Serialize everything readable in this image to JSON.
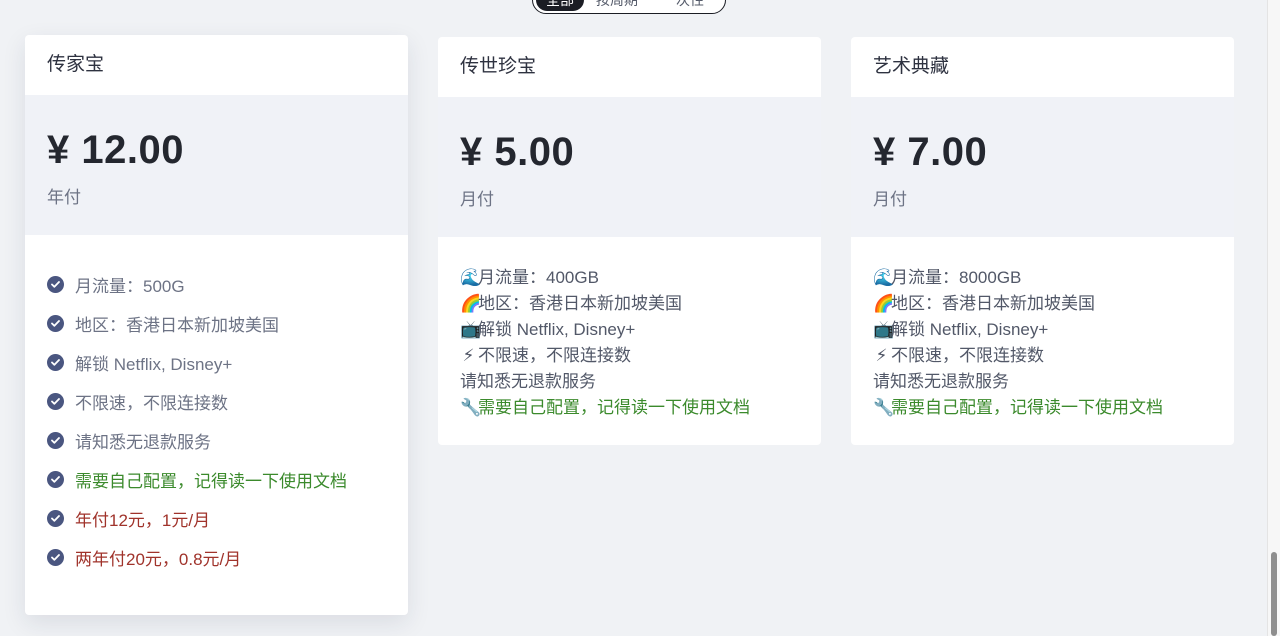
{
  "filter": {
    "tabs": [
      {
        "label": "全部",
        "active": true
      },
      {
        "label": "按周期",
        "active": false
      },
      {
        "label": "一次性",
        "active": false
      }
    ]
  },
  "plans": [
    {
      "name": "传家宝",
      "price": "¥ 12.00",
      "period": "年付",
      "features": [
        {
          "text": "月流量：500G",
          "tone": "normal"
        },
        {
          "text": "地区：香港日本新加坡美国",
          "tone": "normal"
        },
        {
          "text": "解锁 Netflix, Disney+",
          "tone": "normal"
        },
        {
          "text": "不限速，不限连接数",
          "tone": "normal"
        },
        {
          "text": "请知悉无退款服务",
          "tone": "normal"
        },
        {
          "text": "需要自己配置，记得读一下使用文档",
          "tone": "green"
        },
        {
          "text": "年付12元，1元/月",
          "tone": "red"
        },
        {
          "text": "两年付20元，0.8元/月",
          "tone": "red"
        }
      ]
    },
    {
      "name": "传世珍宝",
      "price": "¥ 5.00",
      "period": "月付",
      "lines": [
        {
          "icon": "🌊",
          "text": "月流量：400GB"
        },
        {
          "icon": "🌈",
          "text": "地区：香港日本新加坡美国"
        },
        {
          "icon": "📺",
          "text": "解锁 Netflix, Disney+"
        },
        {
          "icon": "⚡",
          "text": "不限速，不限连接数"
        },
        {
          "icon": "",
          "text": "请知悉无退款服务"
        },
        {
          "icon": "🔧",
          "text": "需要自己配置，记得读一下使用文档"
        }
      ]
    },
    {
      "name": "艺术典藏",
      "price": "¥ 7.00",
      "period": "月付",
      "lines": [
        {
          "icon": "🌊",
          "text": "月流量：8000GB"
        },
        {
          "icon": "🌈",
          "text": "地区：香港日本新加坡美国"
        },
        {
          "icon": "📺",
          "text": "解锁 Netflix, Disney+"
        },
        {
          "icon": "⚡",
          "text": "不限速，不限连接数"
        },
        {
          "icon": "",
          "text": "请知悉无退款服务"
        },
        {
          "icon": "🔧",
          "text": "需要自己配置，记得读一下使用文档"
        }
      ]
    }
  ],
  "colors": {
    "accent_check": "#4a5680",
    "green_text": "#3b8a2c",
    "red_text": "#a0332b",
    "price_panel": "#f0f2f7"
  }
}
